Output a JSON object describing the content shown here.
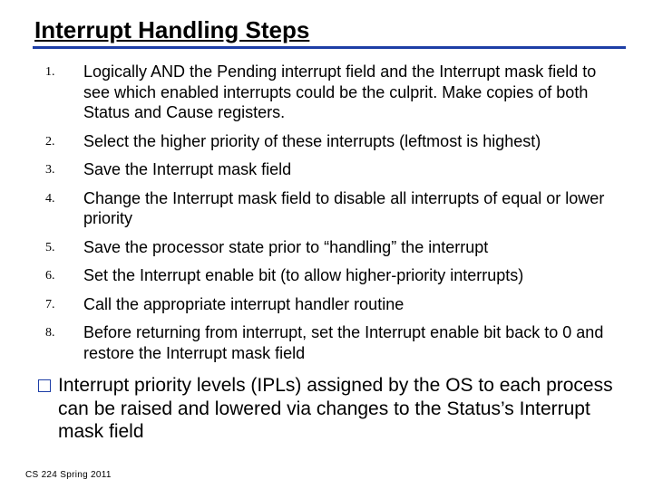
{
  "title": "Interrupt Handling Steps",
  "steps": [
    "Logically AND the Pending interrupt field and the Interrupt mask field to see which enabled interrupts could be the culprit.  Make copies of both Status and Cause registers.",
    "Select the higher priority of these interrupts (leftmost is highest)",
    "Save the Interrupt mask field",
    "Change the Interrupt mask field to disable all interrupts of equal or lower priority",
    "Save the processor state prior to “handling” the interrupt",
    "Set the Interrupt enable bit (to allow higher-priority interrupts)",
    "Call the appropriate interrupt handler routine",
    "Before returning from interrupt, set the Interrupt enable bit back to 0 and restore the Interrupt mask field"
  ],
  "note": "Interrupt priority levels (IPLs) assigned by the OS to each process can be raised and lowered via changes to the Status’s Interrupt mask field",
  "footer": "CS 224 Spring 2011"
}
